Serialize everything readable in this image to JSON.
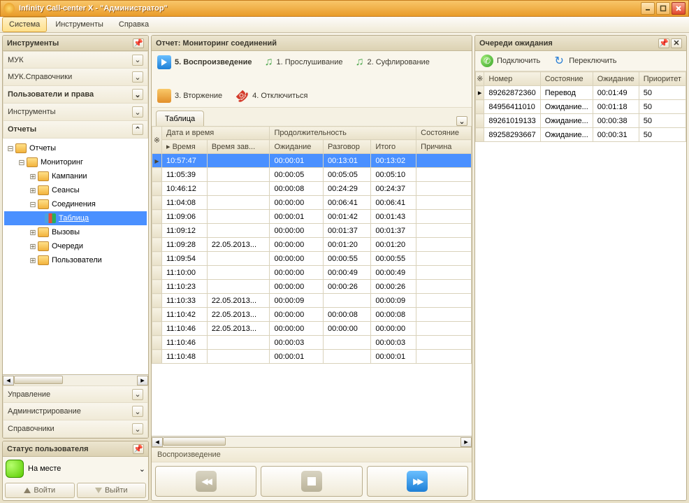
{
  "window": {
    "title": "Infinity Call-center X - \"Администратор\""
  },
  "menu": {
    "items": [
      "Система",
      "Инструменты",
      "Справка"
    ],
    "selected": 0
  },
  "sidebar": {
    "title": "Инструменты",
    "sections_top": [
      "МУК",
      "МУК.Справочники",
      "Пользователи и права",
      "Инструменты"
    ],
    "reports_label": "Отчеты",
    "tree": {
      "root": "Отчеты",
      "monitoring": "Мониторинг",
      "items": [
        "Кампании",
        "Сеансы",
        "Соединения"
      ],
      "table_leaf": "Таблица",
      "items2": [
        "Вызовы",
        "Очереди",
        "Пользователи"
      ]
    },
    "sections_bottom": [
      "Управление",
      "Администрирование",
      "Справочники"
    ],
    "status_title": "Статус пользователя",
    "status_value": "На месте",
    "login_btn": "Войти",
    "logout_btn": "Выйти"
  },
  "report": {
    "title": "Отчет: Мониторинг соединений",
    "actions": {
      "play": "5. Воспроизведение",
      "listen": "1. Прослушивание",
      "whisper": "2. Суфлирование",
      "barge": "3. Вторжение",
      "hangup": "4. Отключиться"
    },
    "tab": "Таблица",
    "headers": {
      "group_dt": "Дата и время",
      "group_dur": "Продолжительность",
      "group_state": "Состояние",
      "time": "Время",
      "end": "Время зав...",
      "wait": "Ожидание",
      "talk": "Разговор",
      "total": "Итого",
      "reason": "Причина"
    },
    "rows": [
      {
        "time": "10:57:47",
        "end": "",
        "wait": "00:00:01",
        "talk": "00:13:01",
        "total": "00:13:02",
        "reason": ""
      },
      {
        "time": "11:05:39",
        "end": "",
        "wait": "00:00:05",
        "talk": "00:05:05",
        "total": "00:05:10",
        "reason": ""
      },
      {
        "time": "10:46:12",
        "end": "",
        "wait": "00:00:08",
        "talk": "00:24:29",
        "total": "00:24:37",
        "reason": ""
      },
      {
        "time": "11:04:08",
        "end": "",
        "wait": "00:00:00",
        "talk": "00:06:41",
        "total": "00:06:41",
        "reason": ""
      },
      {
        "time": "11:09:06",
        "end": "",
        "wait": "00:00:01",
        "talk": "00:01:42",
        "total": "00:01:43",
        "reason": ""
      },
      {
        "time": "11:09:12",
        "end": "",
        "wait": "00:00:00",
        "talk": "00:01:37",
        "total": "00:01:37",
        "reason": ""
      },
      {
        "time": "11:09:28",
        "end": "22.05.2013...",
        "wait": "00:00:00",
        "talk": "00:01:20",
        "total": "00:01:20",
        "reason": ""
      },
      {
        "time": "11:09:54",
        "end": "",
        "wait": "00:00:00",
        "talk": "00:00:55",
        "total": "00:00:55",
        "reason": ""
      },
      {
        "time": "11:10:00",
        "end": "",
        "wait": "00:00:00",
        "talk": "00:00:49",
        "total": "00:00:49",
        "reason": ""
      },
      {
        "time": "11:10:23",
        "end": "",
        "wait": "00:00:00",
        "talk": "00:00:26",
        "total": "00:00:26",
        "reason": ""
      },
      {
        "time": "11:10:33",
        "end": "22.05.2013...",
        "wait": "00:00:09",
        "talk": "",
        "total": "00:00:09",
        "reason": ""
      },
      {
        "time": "11:10:42",
        "end": "22.05.2013...",
        "wait": "00:00:00",
        "talk": "00:00:08",
        "total": "00:00:08",
        "reason": ""
      },
      {
        "time": "11:10:46",
        "end": "22.05.2013...",
        "wait": "00:00:00",
        "talk": "00:00:00",
        "total": "00:00:00",
        "reason": ""
      },
      {
        "time": "11:10:46",
        "end": "",
        "wait": "00:00:03",
        "talk": "",
        "total": "00:00:03",
        "reason": ""
      },
      {
        "time": "11:10:48",
        "end": "",
        "wait": "00:00:01",
        "talk": "",
        "total": "00:00:01",
        "reason": ""
      }
    ],
    "selected_row": 0,
    "playback_label": "Воспроизведение"
  },
  "queue": {
    "title": "Очереди ожидания",
    "connect": "Подключить",
    "reconnect": "Переключить",
    "headers": {
      "number": "Номер",
      "state": "Состояние",
      "wait": "Ожидание",
      "prio": "Приоритет"
    },
    "rows": [
      {
        "number": "89262872360",
        "state": "Перевод",
        "wait": "00:01:49",
        "prio": "50"
      },
      {
        "number": "84956411010",
        "state": "Ожидание...",
        "wait": "00:01:18",
        "prio": "50"
      },
      {
        "number": "89261019133",
        "state": "Ожидание...",
        "wait": "00:00:38",
        "prio": "50"
      },
      {
        "number": "89258293667",
        "state": "Ожидание...",
        "wait": "00:00:31",
        "prio": "50"
      }
    ]
  }
}
